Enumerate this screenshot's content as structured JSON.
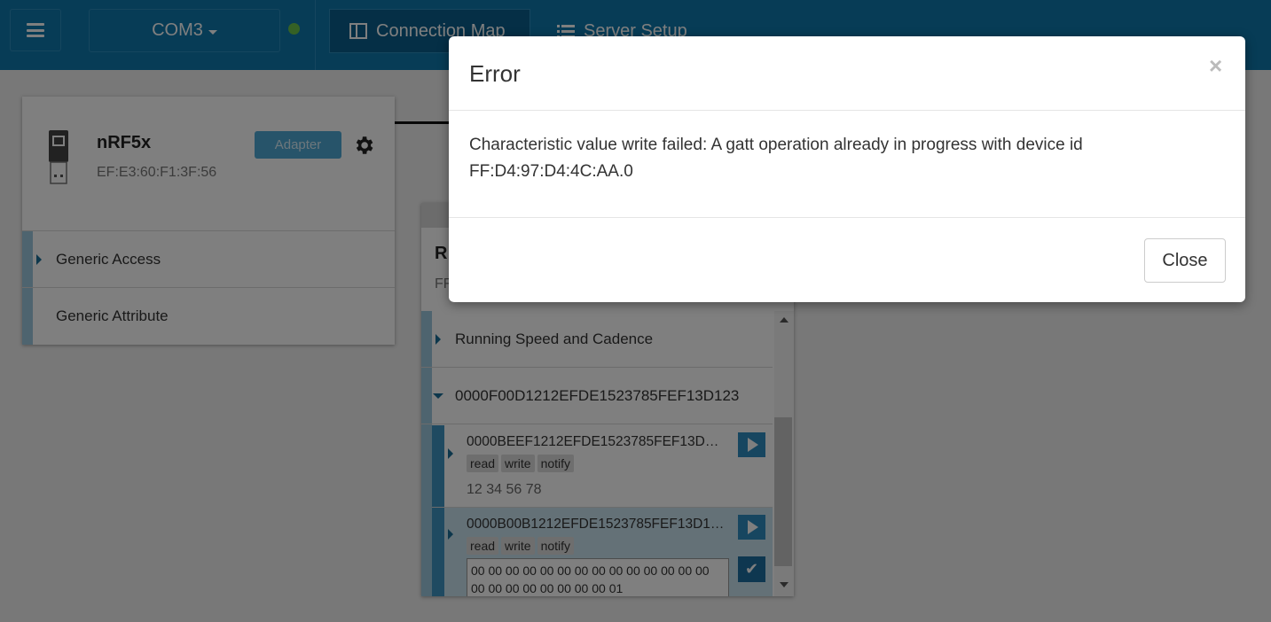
{
  "topbar": {
    "port": "COM3",
    "tabs": [
      {
        "label": "Connection Map",
        "icon": "columns-icon",
        "active": true
      },
      {
        "label": "Server Setup",
        "icon": "list-icon",
        "active": false
      }
    ],
    "status_color": "#6bc24b"
  },
  "adapter": {
    "name": "nRF5x",
    "address": "EF:E3:60:F1:3F:56",
    "badge": "Adapter",
    "services": [
      "Generic Access",
      "Generic Attribute"
    ]
  },
  "peer": {
    "name_partial": "R",
    "address_partial": "FF",
    "services": [
      {
        "label": "Running Speed and Cadence",
        "expanded": false
      },
      {
        "label": "0000F00D1212EFDE1523785FEF13D123",
        "expanded": true
      }
    ],
    "characteristics": [
      {
        "uuid": "0000BEEF1212EFDE1523785FEF13D…",
        "properties": [
          "read",
          "write",
          "notify"
        ],
        "value": "12 34 56 78"
      },
      {
        "uuid": "0000B00B1212EFDE1523785FEF13D1…",
        "properties": [
          "read",
          "write",
          "notify"
        ],
        "value_line1": "00 00 00 00 00 00 00 00 00 00 00 00 00 00",
        "value_line2": "00 00 00 00 00 00 00 00 01"
      }
    ]
  },
  "modal": {
    "title": "Error",
    "close_symbol": "×",
    "message_line1": "Characteristic value write failed: A gatt operation already in progress with device id",
    "message_line2": "FF:D4:97:D4:4C:AA.0",
    "close_button": "Close"
  },
  "colors": {
    "topbar": "#0f78ad",
    "accent": "#2f8dc0"
  }
}
